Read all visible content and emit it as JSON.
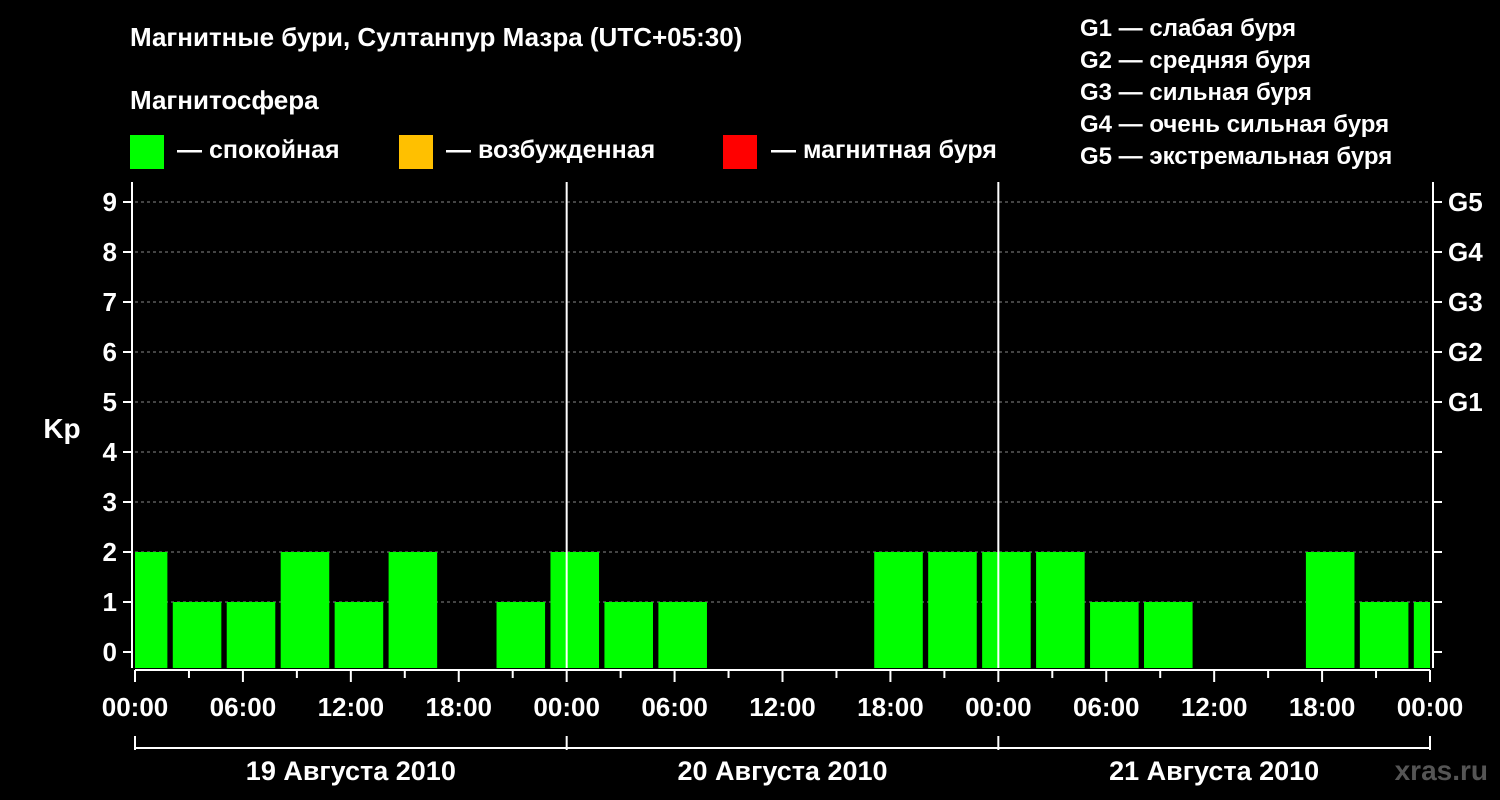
{
  "title": "Магнитные бури, Султанпур Мазра (UTC+05:30)",
  "subtitle": "Магнитосфера",
  "legend": [
    {
      "label": "— спокойная",
      "color": "#00ff00"
    },
    {
      "label": "— возбужденная",
      "color": "#ffc000"
    },
    {
      "label": "— магнитная буря",
      "color": "#ff0000"
    }
  ],
  "g_levels": [
    "G1 — слабая буря",
    "G2 — средняя буря",
    "G3 — сильная буря",
    "G4 — очень сильная буря",
    "G5 — экстремальная буря"
  ],
  "watermark": "xras.ru",
  "chart_data": {
    "type": "bar",
    "ylabel": "Kp",
    "ylim": [
      0,
      9
    ],
    "yticks": [
      "0",
      "1",
      "2",
      "3",
      "4",
      "5",
      "6",
      "7",
      "8",
      "9"
    ],
    "right_ticks": [
      {
        "value": 5,
        "label": "G1"
      },
      {
        "value": 6,
        "label": "G2"
      },
      {
        "value": 7,
        "label": "G3"
      },
      {
        "value": 8,
        "label": "G4"
      },
      {
        "value": 9,
        "label": "G5"
      }
    ],
    "xticks": [
      "00:00",
      "06:00",
      "12:00",
      "18:00",
      "00:00",
      "06:00",
      "12:00",
      "18:00",
      "00:00",
      "06:00",
      "12:00",
      "18:00",
      "00:00"
    ],
    "days": [
      "19 Августа 2010",
      "20 Августа 2010",
      "21 Августа 2010"
    ],
    "period_hours": 72,
    "bar_hours": 3,
    "bar_color": "#00ff00",
    "grid": "horizontal dashed",
    "bars": [
      {
        "start": 0,
        "end": 1.8,
        "value": 2
      },
      {
        "start": 2.1,
        "value": 1
      },
      {
        "start": 5.1,
        "value": 1
      },
      {
        "start": 8.1,
        "value": 2
      },
      {
        "start": 11.1,
        "value": 1
      },
      {
        "start": 14.1,
        "value": 2
      },
      {
        "start": 17.1,
        "value": 0
      },
      {
        "start": 20.1,
        "value": 1
      },
      {
        "start": 23.1,
        "value": 2
      },
      {
        "start": 26.1,
        "value": 1
      },
      {
        "start": 29.1,
        "value": 1
      },
      {
        "start": 32.1,
        "value": 0
      },
      {
        "start": 35.1,
        "value": 0
      },
      {
        "start": 38.1,
        "value": 0
      },
      {
        "start": 41.1,
        "value": 2
      },
      {
        "start": 44.1,
        "value": 2
      },
      {
        "start": 47.1,
        "value": 2
      },
      {
        "start": 50.1,
        "value": 2
      },
      {
        "start": 53.1,
        "value": 1
      },
      {
        "start": 56.1,
        "value": 1
      },
      {
        "start": 59.1,
        "value": 0
      },
      {
        "start": 62.1,
        "value": 0
      },
      {
        "start": 65.1,
        "value": 2
      },
      {
        "start": 68.1,
        "value": 1
      },
      {
        "start": 71.1,
        "end": 72,
        "value": 1
      }
    ]
  }
}
